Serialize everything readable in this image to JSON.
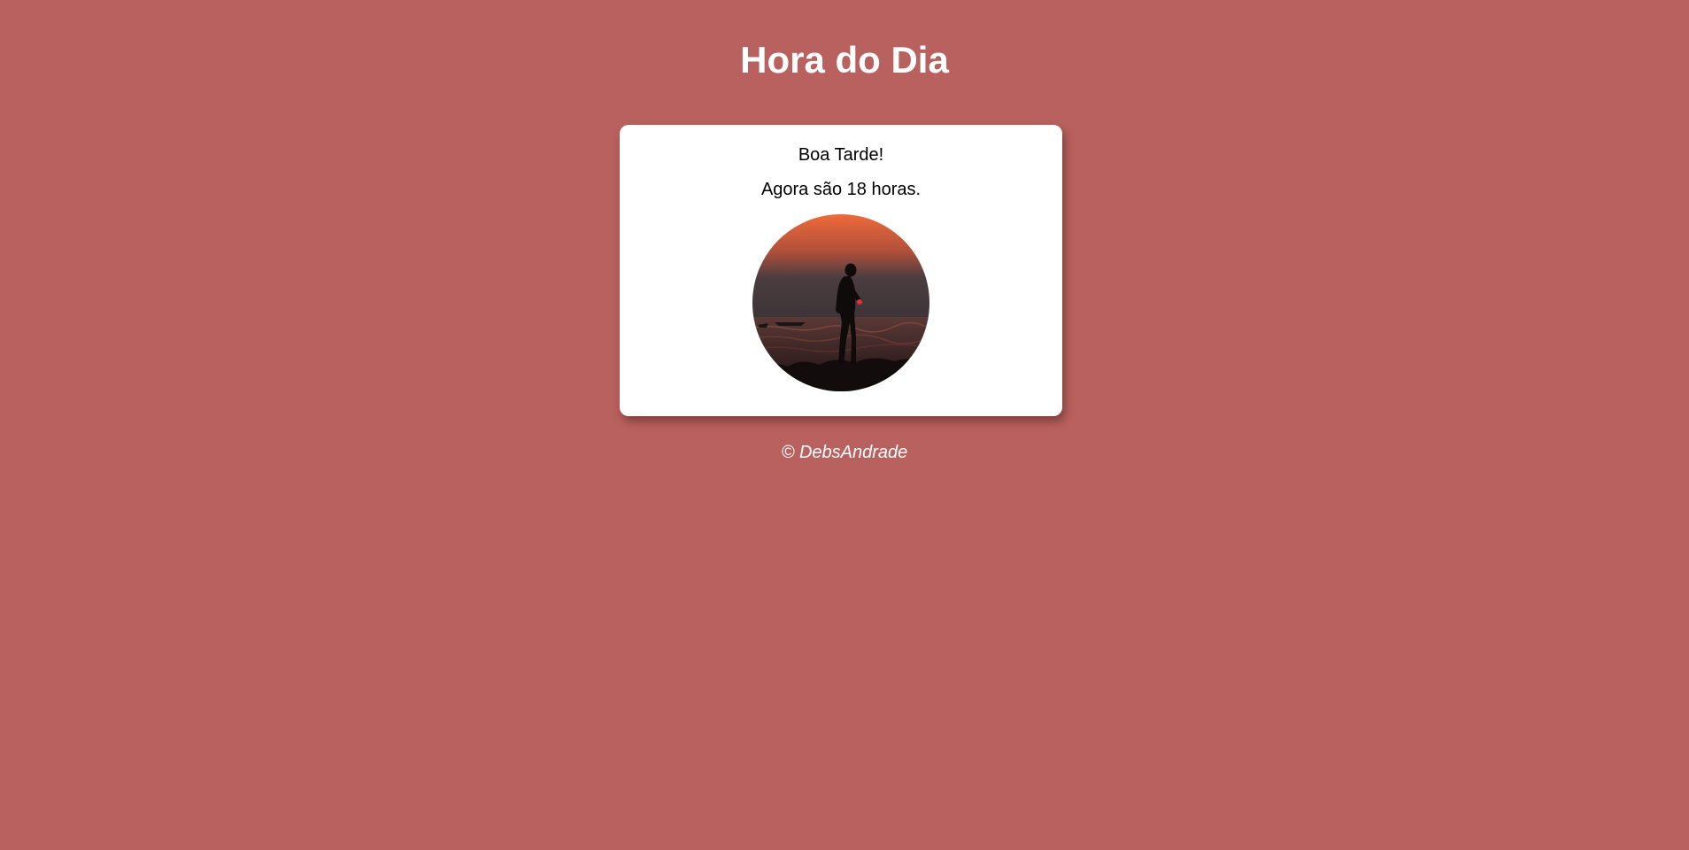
{
  "page": {
    "title": "Hora do Dia",
    "background_color": "#b9615e"
  },
  "card": {
    "greeting": "Boa Tarde!",
    "hour_message": "Agora são 18 horas.",
    "image": {
      "icon": "sunset-silhouette-photo",
      "description_colors": [
        "#ee6a3a",
        "#4a3a3c",
        "#1a1212"
      ]
    }
  },
  "footer": {
    "copyright": "© DebsAndrade"
  }
}
